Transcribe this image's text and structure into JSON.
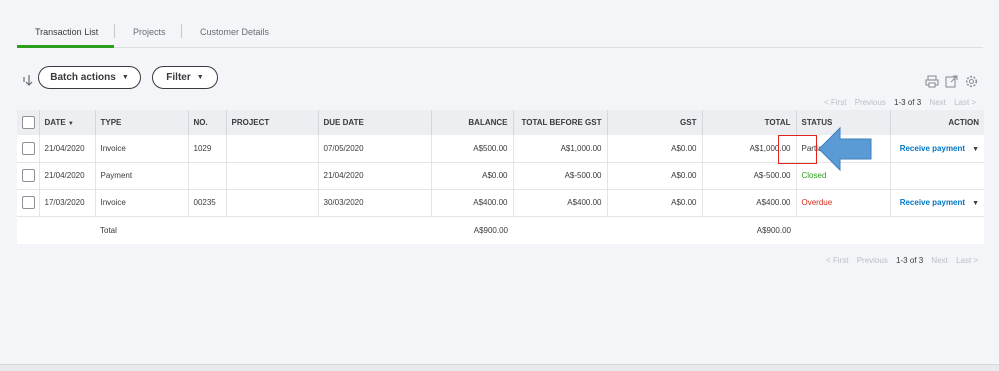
{
  "tabs": [
    {
      "label": "Transaction List"
    },
    {
      "label": "Projects"
    },
    {
      "label": "Customer Details"
    }
  ],
  "toolbar": {
    "batch_actions": "Batch actions",
    "filter": "Filter",
    "icons": [
      "print-icon",
      "export-icon",
      "gear-icon"
    ]
  },
  "pager": {
    "first": "< First",
    "previous": "Previous",
    "range": "1-3 of 3",
    "next": "Next",
    "last": "Last >"
  },
  "table": {
    "headers": {
      "date": "DATE",
      "type": "TYPE",
      "no": "NO.",
      "project": "PROJECT",
      "due_date": "DUE DATE",
      "balance": "BALANCE",
      "total_before_gst": "TOTAL BEFORE GST",
      "gst": "GST",
      "total": "TOTAL",
      "status": "STATUS",
      "action": "ACTION"
    },
    "rows": [
      {
        "date": "21/04/2020",
        "type": "Invoice",
        "no": "1029",
        "project": "",
        "due_date": "07/05/2020",
        "balance": "A$500.00",
        "total_before_gst": "A$1,000.00",
        "gst": "A$0.00",
        "total": "A$1,000.00",
        "status": "Partial",
        "action": "Receive payment"
      },
      {
        "date": "21/04/2020",
        "type": "Payment",
        "no": "",
        "project": "",
        "due_date": "21/04/2020",
        "balance": "A$0.00",
        "total_before_gst": "A$-500.00",
        "gst": "A$0.00",
        "total": "A$-500.00",
        "status": "Closed",
        "action": ""
      },
      {
        "date": "17/03/2020",
        "type": "Invoice",
        "no": "00235",
        "project": "",
        "due_date": "30/03/2020",
        "balance": "A$400.00",
        "total_before_gst": "A$400.00",
        "gst": "A$0.00",
        "total": "A$400.00",
        "status": "Overdue",
        "action": "Receive payment"
      }
    ],
    "total_row": {
      "label": "Total",
      "balance": "A$900.00",
      "total": "A$900.00"
    }
  },
  "colors": {
    "accent_green": "#2ca01c",
    "link_blue": "#0077c5",
    "overdue_red": "#d52b1e",
    "highlight_red": "#e0241b",
    "arrow_blue": "#5b9bd5"
  }
}
